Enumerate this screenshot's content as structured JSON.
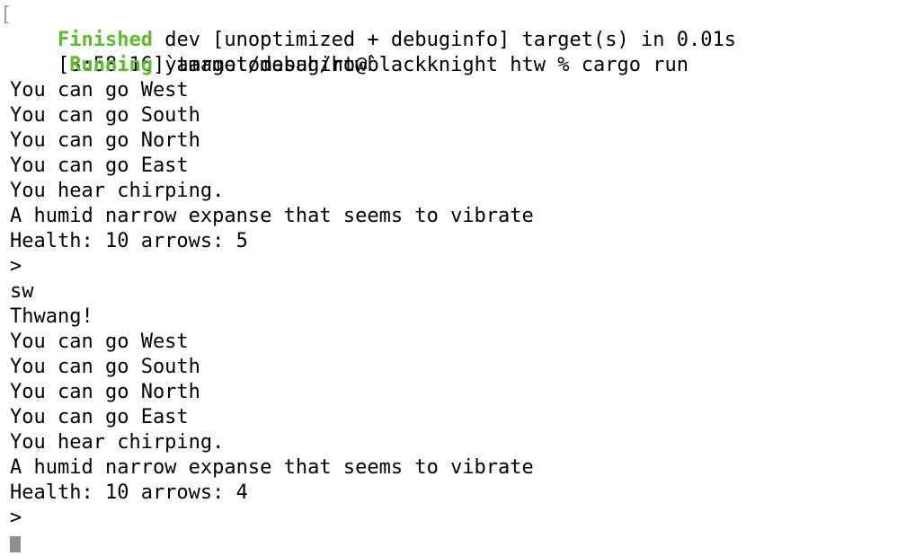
{
  "prompt": {
    "bracket": "[",
    "text": "[3:58:16]yamamotomasahiro@blackknight htw % cargo run"
  },
  "build": {
    "finished_label": "Finished",
    "finished_text": " dev [unoptimized + debuginfo] target(s) in 0.01s",
    "running_label": "Running",
    "running_text": " `target/debug/htw`"
  },
  "output_lines": [
    "You can go West",
    "You can go South",
    "You can go North",
    "You can go East",
    "You hear chirping.",
    "A humid narrow expanse that seems to vibrate",
    "Health: 10 arrows: 5",
    ">",
    "sw",
    "Thwang!",
    "You can go West",
    "You can go South",
    "You can go North",
    "You can go East",
    "You hear chirping.",
    "A humid narrow expanse that seems to vibrate",
    "Health: 10 arrows: 4",
    ">"
  ],
  "colors": {
    "background": "#ffffff",
    "text": "#000000",
    "success_green": "#5cbf2a",
    "cursor": "#8e8e8e"
  }
}
